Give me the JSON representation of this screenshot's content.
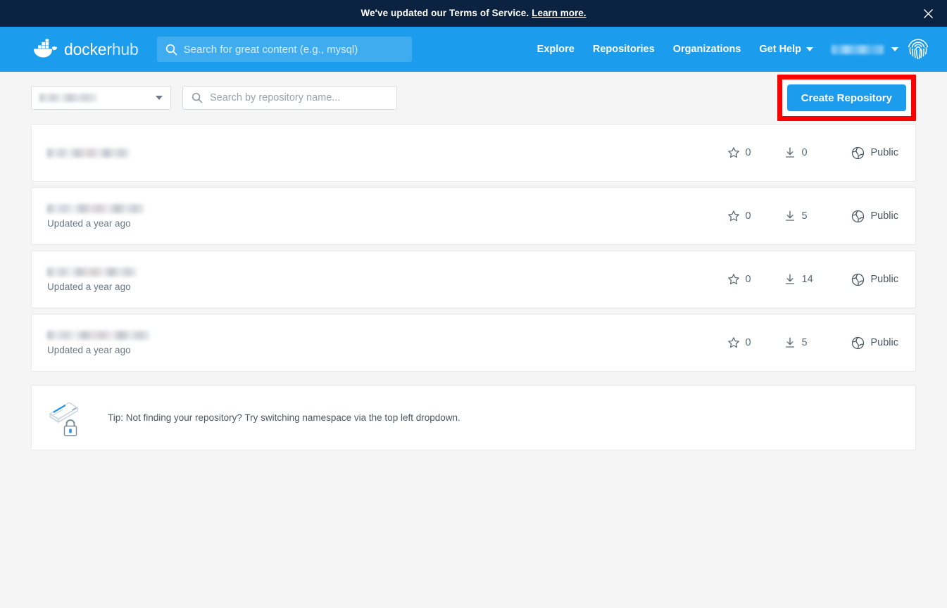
{
  "banner": {
    "text": "We've updated our Terms of Service.",
    "link_label": "Learn more.",
    "close_icon": "close-icon",
    "background_color": "#0b2240"
  },
  "header": {
    "logo": {
      "icon": "docker-whale-icon",
      "word_primary": "docker",
      "word_secondary": "hub"
    },
    "search": {
      "icon": "search-icon",
      "placeholder": "Search for great content (e.g., mysql)",
      "value": ""
    },
    "nav_links": [
      {
        "label": "Explore"
      },
      {
        "label": "Repositories"
      },
      {
        "label": "Organizations"
      },
      {
        "label": "Get Help",
        "has_caret": true
      }
    ],
    "user_menu": {
      "username": "",
      "username_redacted": true,
      "caret_icon": "chevron-down-icon",
      "avatar_icon": "fingerprint-avatar-icon"
    },
    "background_color": "#1b9ced"
  },
  "toolbar": {
    "namespace_select": {
      "value": "",
      "value_redacted": true,
      "caret_icon": "chevron-down-icon"
    },
    "repo_search": {
      "icon": "search-icon",
      "placeholder": "Search by repository name...",
      "value": ""
    },
    "create_button": {
      "label": "Create Repository",
      "highlight_color": "#ff0000",
      "background_color": "#1b9ced"
    }
  },
  "repositories": [
    {
      "name": "",
      "name_redacted": true,
      "updated": "",
      "stars": "0",
      "downloads": "0",
      "visibility": "Public"
    },
    {
      "name": "",
      "name_redacted": true,
      "updated": "Updated a year ago",
      "stars": "0",
      "downloads": "5",
      "visibility": "Public"
    },
    {
      "name": "",
      "name_redacted": true,
      "updated": "Updated a year ago",
      "stars": "0",
      "downloads": "14",
      "visibility": "Public"
    },
    {
      "name": "",
      "name_redacted": true,
      "updated": "Updated a year ago",
      "stars": "0",
      "downloads": "5",
      "visibility": "Public"
    }
  ],
  "icons": {
    "star": "star-icon",
    "download": "download-icon",
    "public": "globe-public-icon",
    "tip": "locked-card-icon"
  },
  "tip": {
    "icon": "locked-card-icon",
    "text": "Tip: Not finding your repository? Try switching namespace via the top left dropdown."
  }
}
